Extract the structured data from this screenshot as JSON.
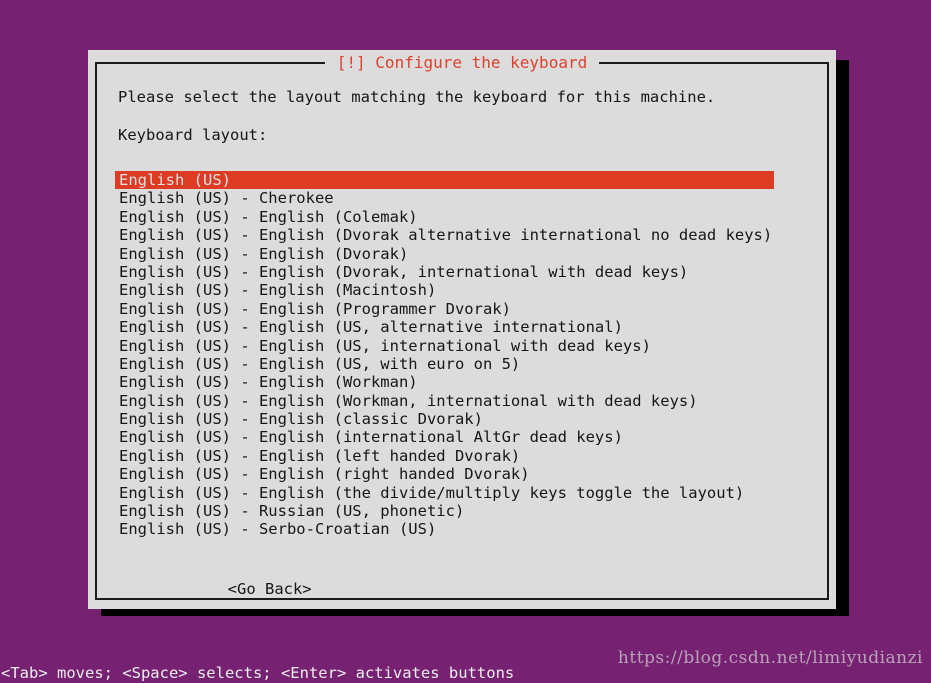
{
  "screen": {
    "background_color": "#772173"
  },
  "dialog": {
    "title": "[!] Configure the keyboard",
    "title_color": "#e0402e",
    "background_color": "#dcdcdc",
    "intro_text": "Please select the layout matching the keyboard for this machine.",
    "layout_label": "Keyboard layout:",
    "selected_index": 0,
    "selection_background": "#dd3b24",
    "selection_foreground": "#e2e2e2",
    "layouts": [
      "English (US)",
      "English (US) - Cherokee",
      "English (US) - English (Colemak)",
      "English (US) - English (Dvorak alternative international no dead keys)",
      "English (US) - English (Dvorak)",
      "English (US) - English (Dvorak, international with dead keys)",
      "English (US) - English (Macintosh)",
      "English (US) - English (Programmer Dvorak)",
      "English (US) - English (US, alternative international)",
      "English (US) - English (US, international with dead keys)",
      "English (US) - English (US, with euro on 5)",
      "English (US) - English (Workman)",
      "English (US) - English (Workman, international with dead keys)",
      "English (US) - English (classic Dvorak)",
      "English (US) - English (international AltGr dead keys)",
      "English (US) - English (left handed Dvorak)",
      "English (US) - English (right handed Dvorak)",
      "English (US) - English (the divide/multiply keys toggle the layout)",
      "English (US) - Russian (US, phonetic)",
      "English (US) - Serbo-Croatian (US)"
    ],
    "go_back_label": "<Go Back>"
  },
  "status_bar": {
    "text": "<Tab> moves; <Space> selects; <Enter> activates buttons"
  },
  "watermark": {
    "text": "https://blog.csdn.net/limiyudianzi"
  }
}
